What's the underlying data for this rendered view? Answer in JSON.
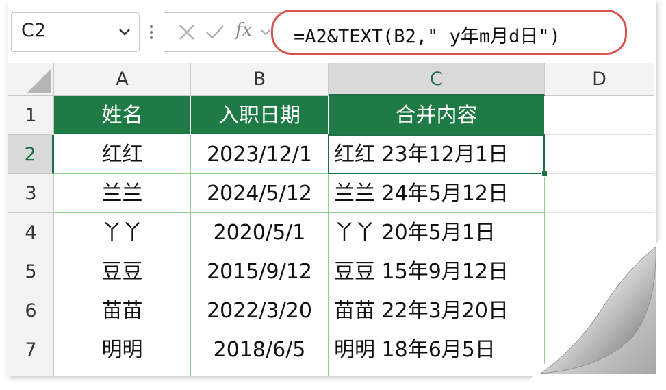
{
  "formula_bar": {
    "name_box": "C2",
    "fx_label": "fx",
    "formula": "=A2&TEXT(B2,\" y年m月d日\")"
  },
  "columns": [
    "A",
    "B",
    "C",
    "D"
  ],
  "rows": [
    "1",
    "2",
    "3",
    "4",
    "5",
    "6",
    "7"
  ],
  "table": {
    "headers": [
      "姓名",
      "入职日期",
      "合并内容"
    ],
    "data": [
      [
        "红红",
        "2023/12/1",
        "红红 23年12月1日"
      ],
      [
        "兰兰",
        "2024/5/12",
        "兰兰 24年5月12日"
      ],
      [
        "丫丫",
        "2020/5/1",
        "丫丫 20年5月1日"
      ],
      [
        "豆豆",
        "2015/9/12",
        "豆豆 15年9月12日"
      ],
      [
        "苗苗",
        "2022/3/20",
        "苗苗 22年3月20日"
      ],
      [
        "明明",
        "2018/6/5",
        "明明 18年6月5日"
      ]
    ]
  },
  "selection": {
    "active_cell": "C2"
  },
  "colors": {
    "header_fill": "#1e7b45",
    "header_text": "#ffffff",
    "selection": "#1e7145",
    "formula_highlight": "#d9534f",
    "grid_green": "#8fd08f"
  }
}
